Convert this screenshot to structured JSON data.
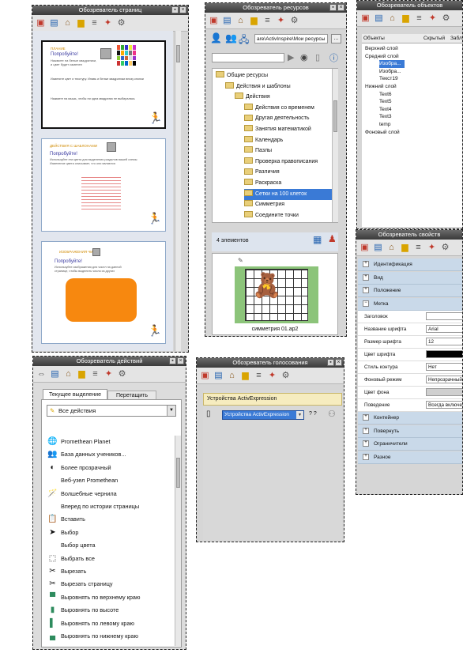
{
  "page_browser": {
    "title": "Обозреватель страниц",
    "card1": {
      "header": "ПЛАНИЕ",
      "try_label": "Попробуйте!",
      "line1": "Нажмите на белые квадратики,",
      "line2": "и цвет будет изменен",
      "desc1": "Измените цвет и текстуру. Ипавь и белые квадратики внизу кнопки",
      "desc2": "Нажмите на мышь, чтобы ни одна квадратик не выбиралась"
    },
    "card2": {
      "header": "ДЕЙСТВИЯ С ШАБЛОНАМИ",
      "try_label": "Попробуйте!",
      "line1": "Используйте эти цвета для выделения разделов вашей схемы",
      "line2": "Изменение цвета описывает, что они являются"
    },
    "card3": {
      "header": "ИЗОБРАЖЕНИЯ ЧИСЕЛ",
      "try_label": "Попробуйте!",
      "line1": "Используйте изображения для чисел на данной",
      "line2": "странице, чтобы выделить числа из других"
    }
  },
  "resource_browser": {
    "title": "Обозреватель ресурсов",
    "path": "are\\ActivInspire\\Мои ресурсы",
    "more_label": "...",
    "tree": [
      {
        "label": "Общие ресурсы",
        "level": 0
      },
      {
        "label": "Действия и шаблоны",
        "level": 1
      },
      {
        "label": "Действия",
        "level": 2
      },
      {
        "label": "Действия со временем",
        "level": 3
      },
      {
        "label": "Другая деятельность",
        "level": 3
      },
      {
        "label": "Занятия математикой",
        "level": 3
      },
      {
        "label": "Календарь",
        "level": 3
      },
      {
        "label": "Пазлы",
        "level": 3
      },
      {
        "label": "Проверка правописания",
        "level": 3
      },
      {
        "label": "Различия",
        "level": 3
      },
      {
        "label": "Раскраска",
        "level": 3
      },
      {
        "label": "Сетки на 100 клеток",
        "level": 3
      },
      {
        "label": "Симметрия",
        "level": 3
      },
      {
        "label": "Соедините точки",
        "level": 3
      }
    ],
    "selected_index": 11,
    "count_label": "4 элементов",
    "preview_caption": "симметрия 01.ap2"
  },
  "object_browser": {
    "title": "Обозреватель объектов",
    "columns": [
      "Объекты",
      "Скрытый",
      "Заблок"
    ],
    "tree": [
      {
        "label": "Верхний слой",
        "level": 0
      },
      {
        "label": "Средний слой",
        "level": 0
      },
      {
        "label": "Изобра...",
        "level": 2
      },
      {
        "label": "Изобра...",
        "level": 2
      },
      {
        "label": "Текст19",
        "level": 2
      },
      {
        "label": "Нижний слой",
        "level": 0
      },
      {
        "label": "Text6",
        "level": 2
      },
      {
        "label": "Text5",
        "level": 2
      },
      {
        "label": "Text4",
        "level": 2
      },
      {
        "label": "Text3",
        "level": 2
      },
      {
        "label": "temp",
        "level": 2
      },
      {
        "label": "Фоновый слой",
        "level": 0
      }
    ]
  },
  "property_browser": {
    "title": "Обозреватель свойств",
    "sections_top": [
      "Идентификация",
      "Вид",
      "Положение",
      "Метка"
    ],
    "rows": [
      {
        "label": "Заголовок",
        "value": ""
      },
      {
        "label": "Название шрифта",
        "value": "Arial"
      },
      {
        "label": "Размер шрифта",
        "value": "12"
      },
      {
        "label": "Цвет шрифта",
        "value": ""
      },
      {
        "label": "Стиль контура",
        "value": "Нет"
      },
      {
        "label": "Фоновый режим",
        "value": "Непрозрачный"
      },
      {
        "label": "Цвет фона",
        "value": ""
      },
      {
        "label": "Поведение",
        "value": "Всегда включено"
      }
    ],
    "sections_bottom": [
      "Контейнер",
      "Повернуть",
      "Ограничители",
      "Разное"
    ],
    "colors": {
      "font_color": "#000000",
      "bg_color": "#cfcfcf"
    }
  },
  "action_browser": {
    "title": "Обозреватель действий",
    "tabs": [
      "Текущее выделение",
      "Перетащить"
    ],
    "dropdown_value": "Все действия",
    "items": [
      {
        "label": "Promethean Planet",
        "icon": "globe"
      },
      {
        "label": "База данных учеников...",
        "icon": "students"
      },
      {
        "label": "Более прозрачный",
        "icon": "transparency"
      },
      {
        "label": "Веб-узел Promethean",
        "icon": "none"
      },
      {
        "label": "Волшебные чернила",
        "icon": "ink"
      },
      {
        "label": "Вперед по истории страницы",
        "icon": "none"
      },
      {
        "label": "Вставить",
        "icon": "paste"
      },
      {
        "label": "Выбор",
        "icon": "cursor"
      },
      {
        "label": "Выбор цвета",
        "icon": "none"
      },
      {
        "label": "Выбрать все",
        "icon": "select-all"
      },
      {
        "label": "Вырезать",
        "icon": "scissors"
      },
      {
        "label": "Вырезать страницу",
        "icon": "cut-page"
      },
      {
        "label": "Выровнять по верхнему краю",
        "icon": "align-top"
      },
      {
        "label": "Выровнять по высоте",
        "icon": "align-height"
      },
      {
        "label": "Выровнять по левому краю",
        "icon": "align-left"
      },
      {
        "label": "Выровнять по нижнему краю",
        "icon": "align-bottom"
      }
    ]
  },
  "voting_browser": {
    "title": "Обозреватель голосования",
    "group_label": "Устройства ActivExpression",
    "dropdown_value": "Устройства ActivExpression",
    "count_label": "? ?"
  }
}
